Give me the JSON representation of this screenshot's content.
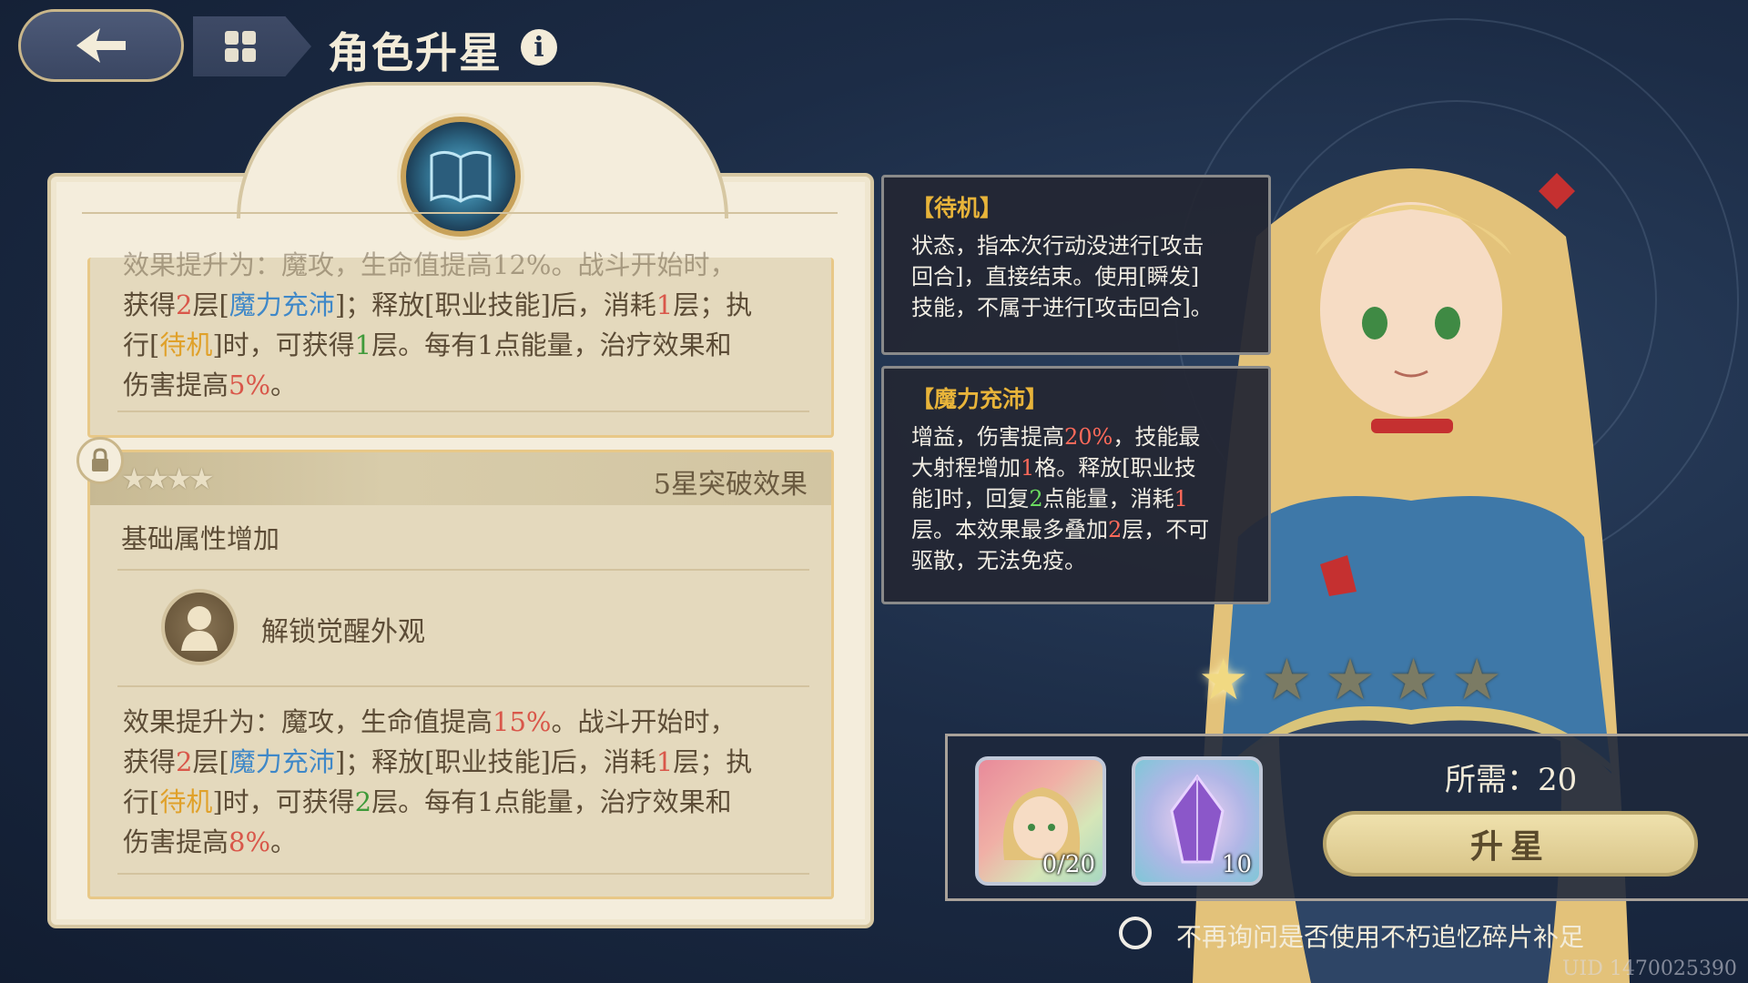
{
  "header": {
    "title": "角色升星",
    "info_icon": "i"
  },
  "panel": {
    "top_card": {
      "line1": "效果提升为：魔攻，生命值提高12%。战斗开始时，",
      "line2_parts": [
        "获得",
        "2",
        "层[",
        "魔力充沛",
        "]；释放[职业技能]后，消耗",
        "1",
        "层；执"
      ],
      "line3_parts": [
        "行[",
        "待机",
        "]时，可获得",
        "1",
        "层。每有1点能量，治疗效果和"
      ],
      "line4_parts": [
        "伤害提高",
        "5%",
        "。"
      ]
    },
    "main_card": {
      "stars": "★★★★",
      "star_title": "5星突破效果",
      "sub_title": "基础属性增加",
      "skin_label": "解锁觉醒外观",
      "line1_parts": [
        "效果提升为：魔攻，生命值提高",
        "15%",
        "。战斗开始时，"
      ],
      "line2_parts": [
        "获得",
        "2",
        "层[",
        "魔力充沛",
        "]；释放[职业技能]后，消耗",
        "1",
        "层；执"
      ],
      "line3_parts": [
        "行[",
        "待机",
        "]时，可获得",
        "2",
        "层。每有1点能量，治疗效果和"
      ],
      "line4_parts": [
        "伤害提高",
        "8%",
        "。"
      ]
    }
  },
  "tooltips": {
    "standby": {
      "title": "【待机】",
      "line1": "状态，指本次行动没进行[攻击",
      "line2": "回合]，直接结束。使用[瞬发]",
      "line3": "技能，不属于进行[攻击回合]。"
    },
    "mana": {
      "title": "【魔力充沛】",
      "line1_parts": [
        "增益，伤害提高",
        "20%",
        "，技能最"
      ],
      "line2_parts": [
        "大射程增加",
        "1",
        "格。释放[职业技"
      ],
      "line3_parts": [
        "能]时，回复",
        "2",
        "点能量，消耗",
        "1"
      ],
      "line4_parts": [
        "层。本效果最多叠加",
        "2",
        "层，不可"
      ],
      "line5": "驱散，无法免疫。"
    }
  },
  "star_rating": {
    "current": 1,
    "max": 5
  },
  "cost": {
    "fragment_count": "0/20",
    "crystal_count": "10",
    "required_label": "所需：20",
    "upgrade_button": "升星"
  },
  "no_ask_label": "不再询问是否使用不朽追忆碎片补足",
  "uid": "UID 1470025390",
  "colors": {
    "highlight_red": "#d9574a",
    "highlight_blue": "#3f88c8",
    "highlight_orange": "#e0a12a",
    "highlight_green": "#3f9a3a",
    "tooltip_title": "#e8b43a"
  },
  "icons": [
    "back-arrow-icon",
    "menu-grid-icon",
    "info-icon",
    "book-emblem-icon",
    "lock-icon",
    "character-silhouette-icon",
    "star-icon",
    "fragment-portrait-icon",
    "crystal-icon",
    "radio-icon"
  ]
}
